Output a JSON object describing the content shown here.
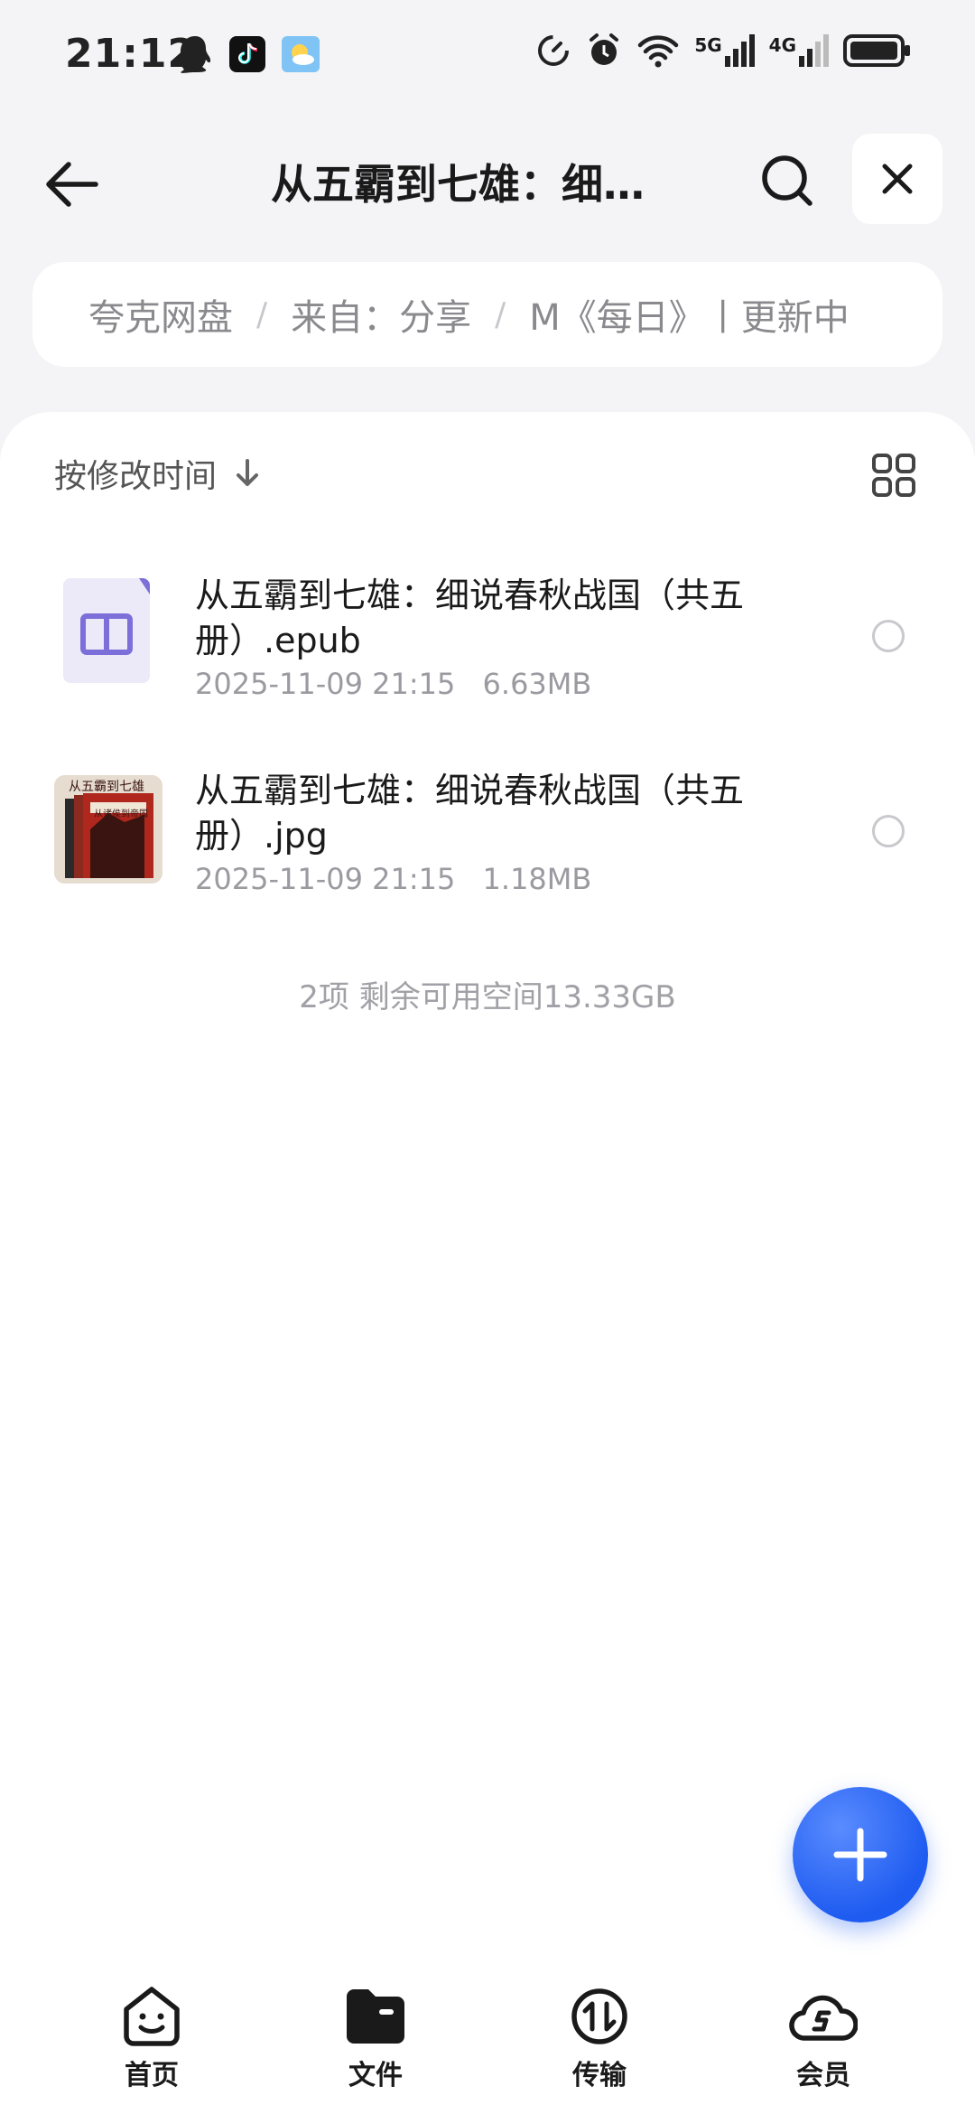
{
  "status_bar": {
    "time": "21:12",
    "network_5g": "5G",
    "network_4g": "4G"
  },
  "header": {
    "title": "从五霸到七雄：细…"
  },
  "breadcrumb": {
    "items": [
      "夸克网盘",
      "来自：分享",
      "M《每日》丨更新中"
    ]
  },
  "toolbar": {
    "sort_label": "按修改时间"
  },
  "files": [
    {
      "name": "从五霸到七雄：细说春秋战国（共五册）.epub",
      "date": "2025-11-09 21:15",
      "size": "6.63MB",
      "type_icon": "book-icon"
    },
    {
      "name": "从五霸到七雄：细说春秋战国（共五册）.jpg",
      "date": "2025-11-09 21:15",
      "size": "1.18MB",
      "thumb_title": "从五霸到七雄",
      "thumb_sub": "从诸侯到帝国"
    }
  ],
  "summary": "2项 剩余可用空间13.33GB",
  "nav": {
    "items": [
      {
        "label": "首页",
        "icon": "home-face-icon"
      },
      {
        "label": "文件",
        "icon": "folder-icon"
      },
      {
        "label": "传输",
        "icon": "transfer-icon"
      },
      {
        "label": "会员",
        "icon": "member-cloud-icon"
      }
    ]
  },
  "colors": {
    "accent": "#1e5bf0",
    "background": "#f4f4f6",
    "text_secondary": "#9a9aa0"
  }
}
